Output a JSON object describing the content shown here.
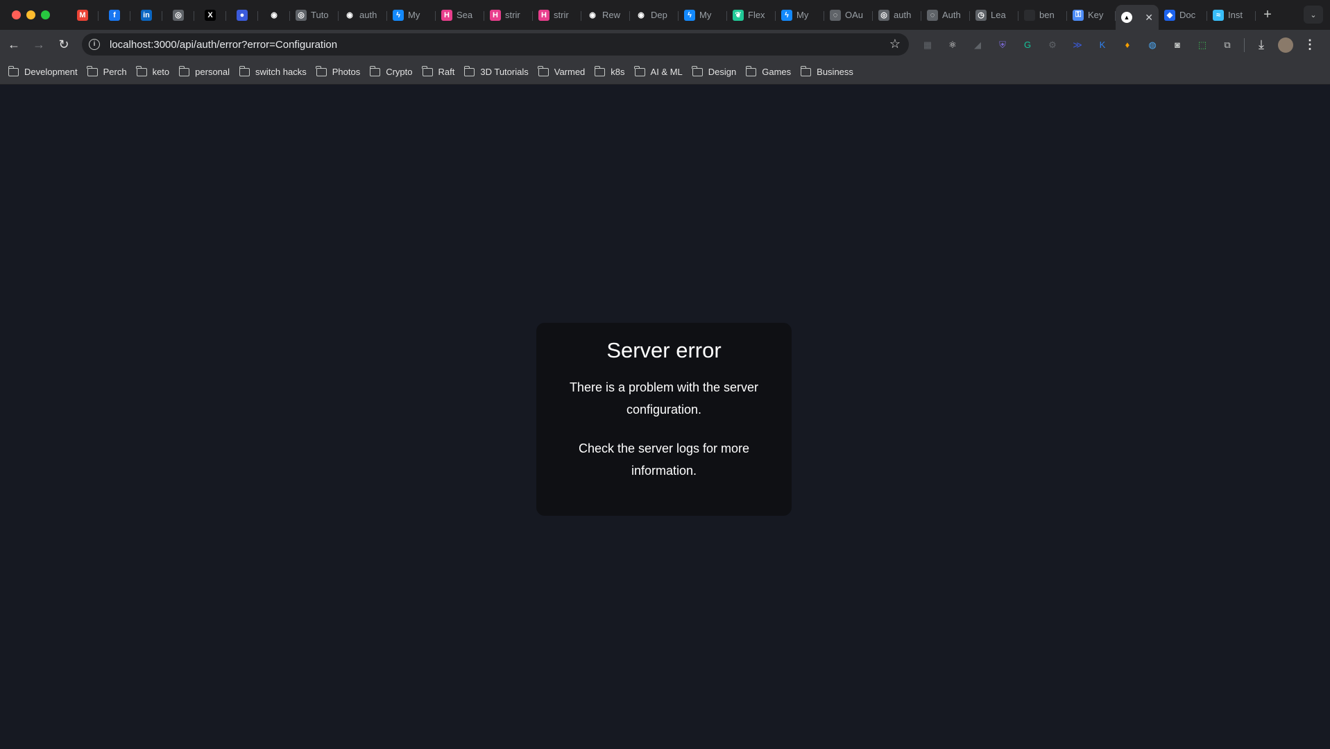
{
  "window_controls": {
    "close_color": "#ff5f57",
    "minimize_color": "#febc2e",
    "maximize_color": "#28c840"
  },
  "tabs": [
    {
      "title": "",
      "icon": "gmail-icon",
      "color": "#ea4335",
      "glyph": "M"
    },
    {
      "title": "",
      "icon": "facebook-icon",
      "color": "#1877f2",
      "glyph": "f"
    },
    {
      "title": "",
      "icon": "linkedin-icon",
      "color": "#0a66c2",
      "glyph": "in"
    },
    {
      "title": "",
      "icon": "chatgpt-icon",
      "color": "#5f6368",
      "glyph": "◎"
    },
    {
      "title": "",
      "icon": "x-icon",
      "color": "#000000",
      "glyph": "X"
    },
    {
      "title": "",
      "icon": "notification-app-icon",
      "color": "#3b5bdb",
      "glyph": "●"
    },
    {
      "title": "",
      "icon": "github-icon",
      "color": "#1f1f21",
      "glyph": "◉"
    },
    {
      "title": "Tuto",
      "icon": "spiral-icon",
      "color": "#5f6368",
      "glyph": "◎"
    },
    {
      "title": "auth",
      "icon": "github-icon",
      "color": "#1f1f21",
      "glyph": "◉"
    },
    {
      "title": "My",
      "icon": "stackblitz-icon",
      "color": "#1389fd",
      "glyph": "ϟ"
    },
    {
      "title": "Sea",
      "icon": "hashnode-icon",
      "color": "#e83e8c",
      "glyph": "H"
    },
    {
      "title": "strir",
      "icon": "hashnode-icon",
      "color": "#e83e8c",
      "glyph": "H"
    },
    {
      "title": "strir",
      "icon": "hashnode-icon",
      "color": "#e83e8c",
      "glyph": "H"
    },
    {
      "title": "Rew",
      "icon": "github-icon",
      "color": "#1f1f21",
      "glyph": "◉"
    },
    {
      "title": "Dep",
      "icon": "github-icon",
      "color": "#1f1f21",
      "glyph": "◉"
    },
    {
      "title": "My",
      "icon": "stackblitz-icon",
      "color": "#1389fd",
      "glyph": "ϟ"
    },
    {
      "title": "Flex",
      "icon": "leaf-icon",
      "color": "#20c997",
      "glyph": "❦"
    },
    {
      "title": "My",
      "icon": "stackblitz-icon",
      "color": "#1389fd",
      "glyph": "ϟ"
    },
    {
      "title": "OAu",
      "icon": "openai-icon",
      "color": "#5f6368",
      "glyph": "◌"
    },
    {
      "title": "auth",
      "icon": "spiral-icon",
      "color": "#5f6368",
      "glyph": "◎"
    },
    {
      "title": "Auth",
      "icon": "openai-icon",
      "color": "#5f6368",
      "glyph": "◌"
    },
    {
      "title": "Lea",
      "icon": "clock-icon",
      "color": "#5f6368",
      "glyph": "◷"
    },
    {
      "title": "ben",
      "icon": "blank-circle-icon",
      "color": "#2b2c2f",
      "glyph": ""
    },
    {
      "title": "Key",
      "icon": "key-icon",
      "color": "#4c8bf5",
      "glyph": "⚿"
    }
  ],
  "active_tab": {
    "icon": "vercel-icon",
    "glyph": "▲",
    "close": "✕"
  },
  "trailing_tabs": [
    {
      "title": "Doc",
      "icon": "docker-icon",
      "color": "#1d63ed",
      "glyph": "◆"
    },
    {
      "title": "Inst",
      "icon": "tailwind-icon",
      "color": "#38bdf8",
      "glyph": "≈"
    }
  ],
  "new_tab_glyph": "+",
  "tab_menu_glyph": "⌄",
  "toolbar": {
    "back": "←",
    "forward": "→",
    "reload": "↻",
    "url": "localhost:3000/api/auth/error?error=Configuration",
    "info_glyph": "i",
    "bookmark_star": "☆"
  },
  "extensions": [
    {
      "icon": "extension-grid-icon",
      "glyph": "▦",
      "color": "#5f6368"
    },
    {
      "icon": "react-devtools-icon",
      "glyph": "⚛",
      "color": "#e3e3e3"
    },
    {
      "icon": "extension-dark-icon",
      "glyph": "◢",
      "color": "#5f6368"
    },
    {
      "icon": "shield-icon",
      "glyph": "⛨",
      "color": "#7c6bd9"
    },
    {
      "icon": "grammarly-icon",
      "glyph": "G",
      "color": "#15c39a"
    },
    {
      "icon": "gear-extension-icon",
      "glyph": "⚙",
      "color": "#5f6368"
    },
    {
      "icon": "bird-extension-icon",
      "glyph": "≫",
      "color": "#3b5bdb"
    },
    {
      "icon": "k-extension-icon",
      "glyph": "K",
      "color": "#2f80ed"
    },
    {
      "icon": "lightbulb-extension-icon",
      "glyph": "♦",
      "color": "#f59f00"
    },
    {
      "icon": "firefox-relay-icon",
      "glyph": "◍",
      "color": "#4dabf7"
    },
    {
      "icon": "camera-icon",
      "glyph": "◙",
      "color": "#c4c7c5"
    },
    {
      "icon": "screenshot-icon",
      "glyph": "⬚",
      "color": "#40c057"
    },
    {
      "icon": "puzzle-icon",
      "glyph": "⧉",
      "color": "#c4c7c5"
    }
  ],
  "download_glyph": "⤓",
  "menu_glyph": "⋮",
  "bookmarks": [
    "Development",
    "Perch",
    "keto",
    "personal",
    "switch hacks",
    "Photos",
    "Crypto",
    "Raft",
    "3D Tutorials",
    "Varmed",
    "k8s",
    "AI & ML",
    "Design",
    "Games",
    "Business"
  ],
  "page": {
    "heading": "Server error",
    "message": "There is a problem with the server configuration.",
    "hint": "Check the server logs for more information."
  }
}
